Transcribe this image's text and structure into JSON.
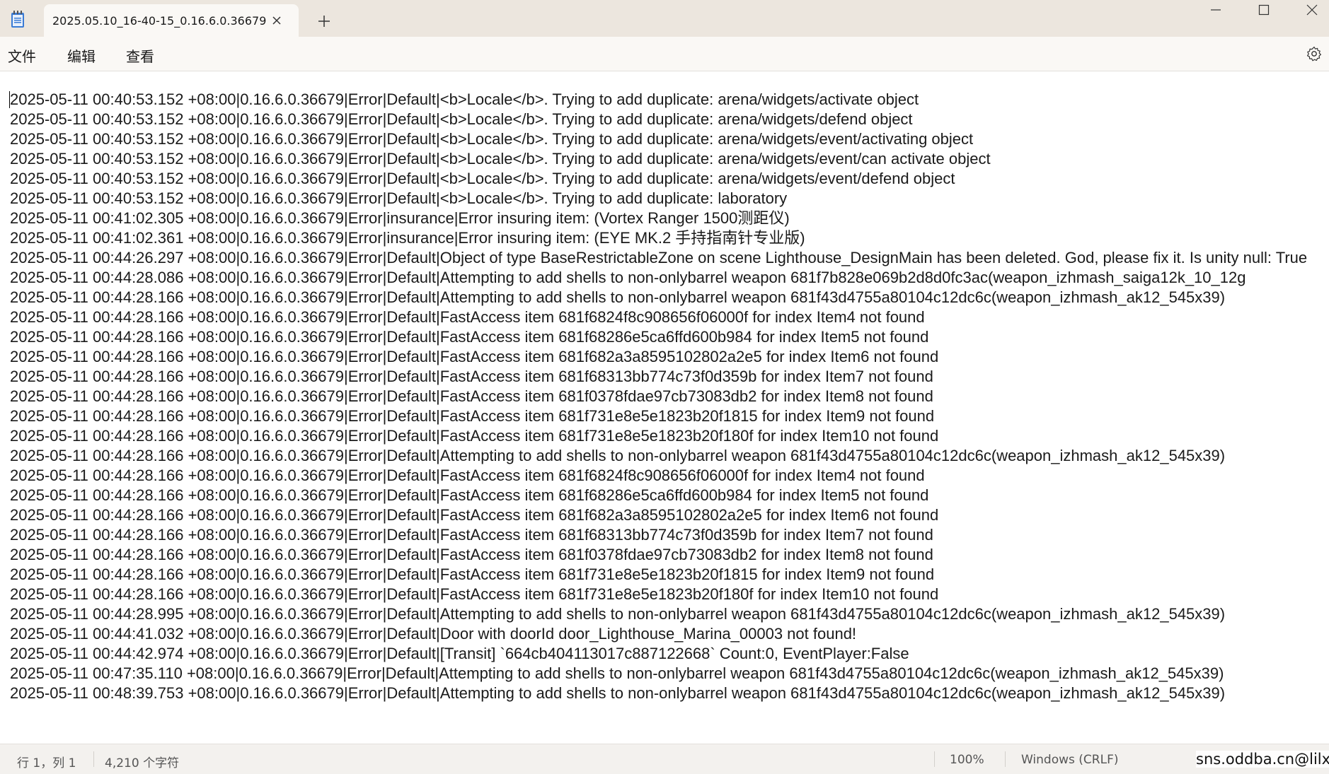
{
  "window": {
    "tab_title": "2025.05.10_16-40-15_0.16.6.0.36679"
  },
  "menu": {
    "file": "文件",
    "edit": "编辑",
    "view": "查看"
  },
  "editor": {
    "lines": [
      "2025-05-11 00:40:53.152 +08:00|0.16.6.0.36679|Error|Default|<b>Locale</b>. Trying to add duplicate: arena/widgets/activate object",
      "2025-05-11 00:40:53.152 +08:00|0.16.6.0.36679|Error|Default|<b>Locale</b>. Trying to add duplicate: arena/widgets/defend object",
      "2025-05-11 00:40:53.152 +08:00|0.16.6.0.36679|Error|Default|<b>Locale</b>. Trying to add duplicate: arena/widgets/event/activating object",
      "2025-05-11 00:40:53.152 +08:00|0.16.6.0.36679|Error|Default|<b>Locale</b>. Trying to add duplicate: arena/widgets/event/can activate object",
      "2025-05-11 00:40:53.152 +08:00|0.16.6.0.36679|Error|Default|<b>Locale</b>. Trying to add duplicate: arena/widgets/event/defend object",
      "2025-05-11 00:40:53.152 +08:00|0.16.6.0.36679|Error|Default|<b>Locale</b>. Trying to add duplicate: laboratory",
      "2025-05-11 00:41:02.305 +08:00|0.16.6.0.36679|Error|insurance|Error insuring item: (Vortex Ranger 1500测距仪)",
      "2025-05-11 00:41:02.361 +08:00|0.16.6.0.36679|Error|insurance|Error insuring item: (EYE MK.2 手持指南针专业版)",
      "2025-05-11 00:44:26.297 +08:00|0.16.6.0.36679|Error|Default|Object of type BaseRestrictableZone on scene Lighthouse_DesignMain has been deleted. God, please fix it. Is unity null: True",
      "2025-05-11 00:44:28.086 +08:00|0.16.6.0.36679|Error|Default|Attempting to add shells to non-onlybarrel weapon 681f7b828e069b2d8d0fc3ac(weapon_izhmash_saiga12k_10_12g",
      "2025-05-11 00:44:28.166 +08:00|0.16.6.0.36679|Error|Default|Attempting to add shells to non-onlybarrel weapon 681f43d4755a80104c12dc6c(weapon_izhmash_ak12_545x39)",
      "2025-05-11 00:44:28.166 +08:00|0.16.6.0.36679|Error|Default|FastAccess item 681f6824f8c908656f06000f for index Item4 not found",
      "2025-05-11 00:44:28.166 +08:00|0.16.6.0.36679|Error|Default|FastAccess item 681f68286e5ca6ffd600b984 for index Item5 not found",
      "2025-05-11 00:44:28.166 +08:00|0.16.6.0.36679|Error|Default|FastAccess item 681f682a3a8595102802a2e5 for index Item6 not found",
      "2025-05-11 00:44:28.166 +08:00|0.16.6.0.36679|Error|Default|FastAccess item 681f68313bb774c73f0d359b for index Item7 not found",
      "2025-05-11 00:44:28.166 +08:00|0.16.6.0.36679|Error|Default|FastAccess item 681f0378fdae97cb73083db2 for index Item8 not found",
      "2025-05-11 00:44:28.166 +08:00|0.16.6.0.36679|Error|Default|FastAccess item 681f731e8e5e1823b20f1815 for index Item9 not found",
      "2025-05-11 00:44:28.166 +08:00|0.16.6.0.36679|Error|Default|FastAccess item 681f731e8e5e1823b20f180f for index Item10 not found",
      "2025-05-11 00:44:28.166 +08:00|0.16.6.0.36679|Error|Default|Attempting to add shells to non-onlybarrel weapon 681f43d4755a80104c12dc6c(weapon_izhmash_ak12_545x39)",
      "2025-05-11 00:44:28.166 +08:00|0.16.6.0.36679|Error|Default|FastAccess item 681f6824f8c908656f06000f for index Item4 not found",
      "2025-05-11 00:44:28.166 +08:00|0.16.6.0.36679|Error|Default|FastAccess item 681f68286e5ca6ffd600b984 for index Item5 not found",
      "2025-05-11 00:44:28.166 +08:00|0.16.6.0.36679|Error|Default|FastAccess item 681f682a3a8595102802a2e5 for index Item6 not found",
      "2025-05-11 00:44:28.166 +08:00|0.16.6.0.36679|Error|Default|FastAccess item 681f68313bb774c73f0d359b for index Item7 not found",
      "2025-05-11 00:44:28.166 +08:00|0.16.6.0.36679|Error|Default|FastAccess item 681f0378fdae97cb73083db2 for index Item8 not found",
      "2025-05-11 00:44:28.166 +08:00|0.16.6.0.36679|Error|Default|FastAccess item 681f731e8e5e1823b20f1815 for index Item9 not found",
      "2025-05-11 00:44:28.166 +08:00|0.16.6.0.36679|Error|Default|FastAccess item 681f731e8e5e1823b20f180f for index Item10 not found",
      "2025-05-11 00:44:28.995 +08:00|0.16.6.0.36679|Error|Default|Attempting to add shells to non-onlybarrel weapon 681f43d4755a80104c12dc6c(weapon_izhmash_ak12_545x39)",
      "2025-05-11 00:44:41.032 +08:00|0.16.6.0.36679|Error|Default|Door with doorId door_Lighthouse_Marina_00003 not found!",
      "2025-05-11 00:44:42.974 +08:00|0.16.6.0.36679|Error|Default|[Transit] `664cb404113017c887122668` Count:0, EventPlayer:False",
      "2025-05-11 00:47:35.110 +08:00|0.16.6.0.36679|Error|Default|Attempting to add shells to non-onlybarrel weapon 681f43d4755a80104c12dc6c(weapon_izhmash_ak12_545x39)",
      "2025-05-11 00:48:39.753 +08:00|0.16.6.0.36679|Error|Default|Attempting to add shells to non-onlybarrel weapon 681f43d4755a80104c12dc6c(weapon_izhmash_ak12_545x39)"
    ]
  },
  "status": {
    "position": "行 1，列 1",
    "char_count": "4,210 个字符",
    "zoom": "100%",
    "line_ending": "Windows (CRLF)",
    "watermark": "sns.oddba.cn@lilx"
  },
  "colors": {
    "titlebar_bg": "#ece6de",
    "tab_bg": "#faf8f5",
    "editor_bg": "#ffffff",
    "statusbar_bg": "#f3f1ee"
  },
  "icons": {
    "app": "notepad-icon",
    "tab_close": "close-icon",
    "new_tab": "plus-icon",
    "minimize": "minimize-icon",
    "maximize": "maximize-icon",
    "close": "close-icon",
    "settings": "gear-icon"
  }
}
